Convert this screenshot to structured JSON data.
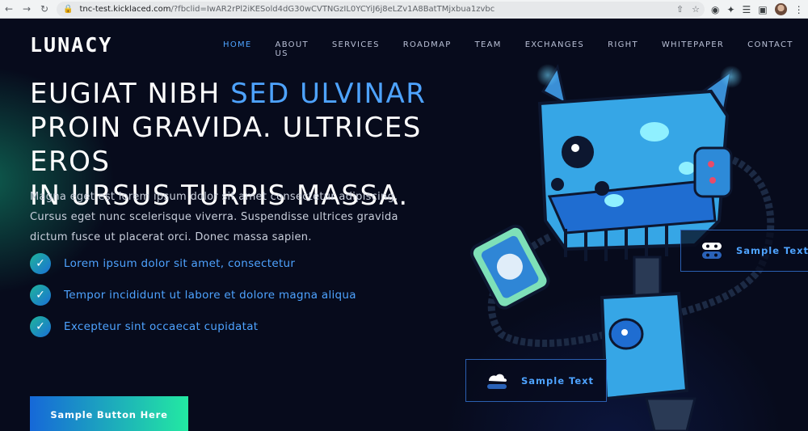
{
  "browser": {
    "url_domain": "tnc-test.kicklaced.com",
    "url_path": "/?fbclid=IwAR2rPl2iKESold4dG30wCVTNGzIL0YCYiJ6j8eLZv1A8BatTMjxbua1zvbc"
  },
  "brand": {
    "logo": "LUNACY"
  },
  "nav": {
    "items": [
      {
        "label": "HOME",
        "active": true
      },
      {
        "label": "ABOUT US"
      },
      {
        "label": "SERVICES"
      },
      {
        "label": "ROADMAP"
      },
      {
        "label": "TEAM"
      },
      {
        "label": "EXCHANGES"
      },
      {
        "label": "RIGHT"
      },
      {
        "label": "WHITEPAPER"
      },
      {
        "label": "CONTACT"
      }
    ]
  },
  "hero": {
    "headline_part1": "EUGIAT NIBH ",
    "headline_highlight": "SED ULVINAR",
    "headline_line2": "PROIN GRAVIDA. ULTRICES EROS",
    "headline_line3": "IN URSUS TURPIS MASSA.",
    "paragraph_line1": "Magna eget est lorem ipsum dolor sit amet consectetur adipiscing.",
    "paragraph_line2": "Cursus eget nunc scelerisque viverra. Suspendisse ultrices gravida",
    "paragraph_line3": "dictum fusce ut placerat orci. Donec massa sapien.",
    "features": [
      "Lorem ipsum dolor sit amet, consectetur",
      "Tempor incididunt ut labore et dolore magna aliqua",
      "Excepteur sint occaecat cupidatat"
    ],
    "cta_label": "Sample Button Here"
  },
  "cards": [
    {
      "label": "Sample Text",
      "icon": "robot-chat-icon"
    },
    {
      "label": "Sample Text",
      "icon": "cloud-stack-icon"
    }
  ],
  "colors": {
    "background": "#070b1c",
    "accent": "#4ea3ff",
    "gradient_start": "#1668d8",
    "gradient_end": "#23e9a2"
  }
}
